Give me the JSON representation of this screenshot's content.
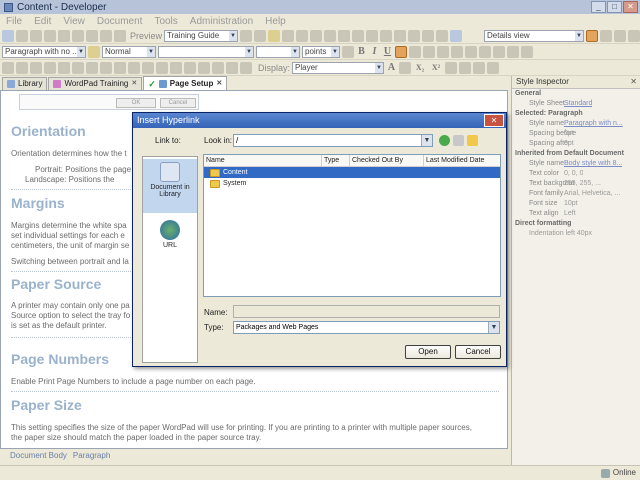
{
  "window": {
    "title": "Content - Developer"
  },
  "menu": [
    "File",
    "Edit",
    "View",
    "Document",
    "Tools",
    "Administration",
    "Help"
  ],
  "toolbar1": {
    "preview_label": "Preview",
    "template_value": "Training Guide",
    "view_value": "Details view"
  },
  "toolbar2": {
    "paragraph_value": "Paragraph with no ...",
    "style_value": "Normal",
    "units_value": "points"
  },
  "toolbar3": {
    "display_label": "Display:",
    "display_value": "Player"
  },
  "tabs": [
    {
      "label": "Library"
    },
    {
      "label": "WordPad Training"
    },
    {
      "label": "Page Setup"
    }
  ],
  "document": {
    "preview_buttons": [
      "OK",
      "Cancel"
    ],
    "h_orientation": "Orientation",
    "p_orientation": "Orientation determines how the t",
    "p_portrait": "Portrait: Positions the page",
    "p_landscape": "Landscape: Positions the",
    "h_margins": "Margins",
    "p_margins1": "Margins determine the white spa",
    "p_margins2": "set individual settings for each e",
    "p_margins3": "centimeters, the unit of margin se",
    "p_switching": "Switching between portrait and la",
    "h_paper_source": "Paper Source",
    "p_source1": "A printer may contain only one pa",
    "p_source2": "Source option to select the tray fo",
    "p_source3": "is set as the default printer.",
    "h_page_numbers": "Page Numbers",
    "p_page_numbers": "Enable Print Page Numbers to include a page number on each page.",
    "h_paper_size": "Paper Size",
    "p_size1": "This setting specifies the size of the paper WordPad will use for printing. If you are printing to a printer with multiple paper sources,",
    "p_size2": "the paper size should match the paper loaded in the paper source tray."
  },
  "breadcrumb": [
    "Document Body",
    "Paragraph"
  ],
  "status": {
    "online": "Online"
  },
  "inspector": {
    "title": "Style Inspector",
    "rows": [
      {
        "section": "General"
      },
      {
        "key": "Style Sheet",
        "value": "Standard",
        "link": true
      },
      {
        "section": "Selected: Paragraph"
      },
      {
        "key": "Style name",
        "value": "Paragraph with n...",
        "link": true
      },
      {
        "key": "Spacing before",
        "value": "0pt"
      },
      {
        "key": "Spacing after",
        "value": "0pt"
      },
      {
        "section": "Inherited from Default Document"
      },
      {
        "key": "Style name",
        "value": "Body style with 8...",
        "link": true
      },
      {
        "key": "Text color",
        "value": "0, 0, 0"
      },
      {
        "key": "Text backgrour",
        "value": "255, 255, ..."
      },
      {
        "key": "Font family",
        "value": "Arial, Helvetica, ..."
      },
      {
        "key": "Font size",
        "value": "10pt"
      },
      {
        "key": "Text align",
        "value": "Left"
      },
      {
        "section": "Direct formatting"
      },
      {
        "value": "Indentation left 40px"
      }
    ]
  },
  "dialog": {
    "title": "Insert Hyperlink",
    "close_label": "✕",
    "link_to_label": "Link to:",
    "look_in_label": "Look in:",
    "look_in_value": "/",
    "sidebar": [
      {
        "label": "Document in Library"
      },
      {
        "label": "URL"
      }
    ],
    "columns": [
      "Name",
      "Type",
      "Checked Out By",
      "Last Modified Date"
    ],
    "files": [
      {
        "name": "Content",
        "selected": true
      },
      {
        "name": "System",
        "selected": false
      }
    ],
    "name_label": "Name:",
    "name_value": "",
    "type_label": "Type:",
    "type_value": "Packages and Web Pages",
    "open_label": "Open",
    "cancel_label": "Cancel"
  }
}
